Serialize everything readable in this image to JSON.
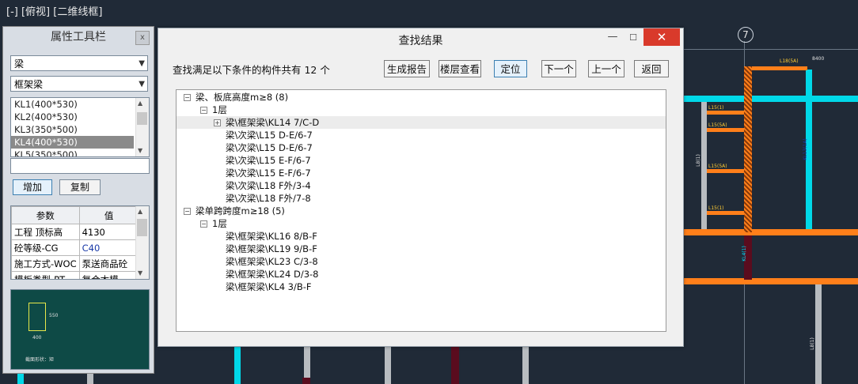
{
  "viewport": {
    "label": "[-] [俯视] [二维线框]",
    "axis_number": "7",
    "dimension": "8400"
  },
  "panel": {
    "title": "属性工具栏",
    "close": "x",
    "type_select": "梁",
    "subtype_select": "框架梁",
    "beam_list": [
      "KL1(400*530)",
      "KL2(400*530)",
      "KL3(350*500)",
      "KL4(400*530)",
      "KL5(350*500)"
    ],
    "selected_index": 3,
    "add_button": "增加",
    "copy_button": "复制",
    "grid_headers": [
      "参数",
      "值"
    ],
    "grid_rows": [
      {
        "param": "工程 顶标高",
        "value": "4130"
      },
      {
        "param": "砼等级-CG",
        "value": "C40"
      },
      {
        "param": "施工方式-WOC",
        "value": "泵送商品砼"
      },
      {
        "param": "模板类型-PT",
        "value": "复合木模"
      }
    ],
    "preview": {
      "dim_h": "550",
      "dim_w": "400",
      "caption": "截面形状：矩"
    }
  },
  "dialog": {
    "title": "查找结果",
    "minimize": "—",
    "maximize": "☐",
    "close": "✕",
    "summary": "查找满足以下条件的构件共有 12 个",
    "buttons": {
      "report": "生成报告",
      "floor_view": "楼层查看",
      "locate": "定位",
      "next": "下一个",
      "prev": "上一个",
      "back": "返回"
    },
    "tree": {
      "group1": {
        "label": "梁、板底高度m≥8 (8)",
        "floor": "1层",
        "items": [
          "梁\\框架梁\\KL14  7/C-D",
          "梁\\次梁\\L15  D-E/6-7",
          "梁\\次梁\\L15  D-E/6-7",
          "梁\\次梁\\L15  E-F/6-7",
          "梁\\次梁\\L15  E-F/6-7",
          "梁\\次梁\\L18  F外/3-4",
          "梁\\次梁\\L18  F外/7-8"
        ]
      },
      "group2": {
        "label": "梁单跨跨度m≥18 (5)",
        "floor": "1层",
        "items": [
          "梁\\框架梁\\KL16  8/B-F",
          "梁\\框架梁\\KL19  9/B-F",
          "梁\\框架梁\\KL23  C/3-8",
          "梁\\框架梁\\KL24  D/3-8",
          "梁\\框架梁\\KL4  3/B-F"
        ]
      }
    }
  },
  "cad_labels": {
    "l1": "L18(5A)",
    "l2": "L15(1)",
    "l3": "L15(5A)",
    "l4": "L15(5A)",
    "l5": "L15(1)",
    "v1": "KL13(1A)",
    "v2": "L8(1)",
    "v3": "L8(1)",
    "v4": "KL4(1)"
  },
  "colors": {
    "cad_bg": "#202a37",
    "cyan_beam": "#00d8e8",
    "orange_beam": "#ff7f1a",
    "close_red": "#d93a2b",
    "accent": "#3c7fb1"
  }
}
